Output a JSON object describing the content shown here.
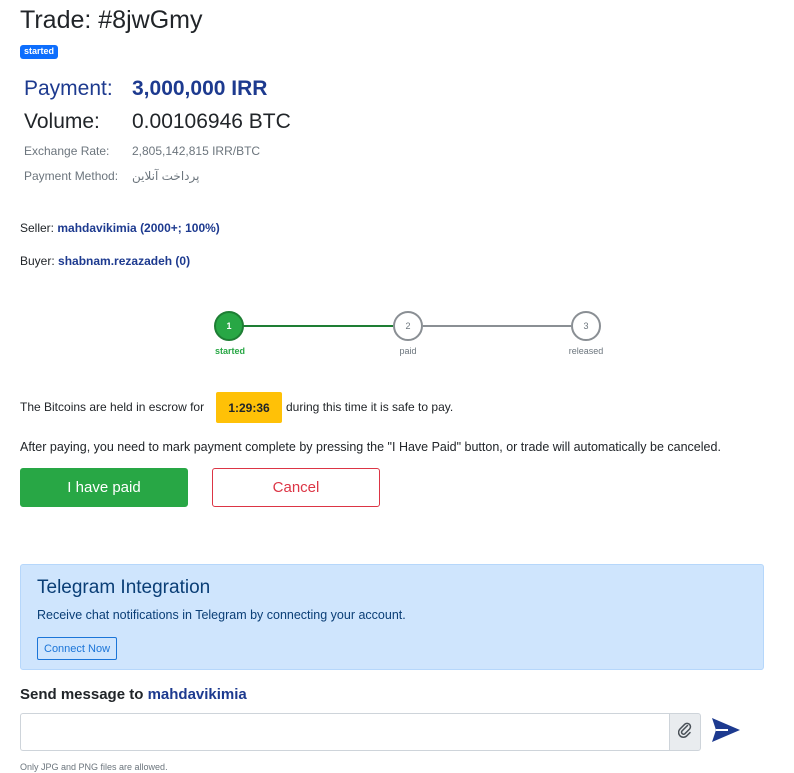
{
  "trade": {
    "title": "Trade: #8jwGmy",
    "status": "started"
  },
  "details": {
    "payment_label": "Payment:",
    "payment_value": "3,000,000 IRR",
    "volume_label": "Volume:",
    "volume_value": "0.00106946 BTC",
    "rate_label": "Exchange Rate:",
    "rate_value": "2,805,142,815 IRR/BTC",
    "method_label": "Payment Method:",
    "method_value": "پرداخت آنلاین"
  },
  "parties": {
    "seller_label": "Seller:",
    "seller_value": "mahdavikimia (2000+; 100%)",
    "buyer_label": "Buyer:",
    "buyer_value": "shabnam.rezazadeh (0)"
  },
  "stepper": {
    "steps": [
      {
        "number": "1",
        "label": "started"
      },
      {
        "number": "2",
        "label": "paid"
      },
      {
        "number": "3",
        "label": "released"
      }
    ],
    "active_step": 1
  },
  "escrow": {
    "text_before": "The Bitcoins are held in escrow for",
    "timer": "1:29:36",
    "text_after": "during this time it is safe to pay.",
    "instructions": "After paying, you need to mark payment complete by pressing the \"I Have Paid\" button, or trade will automatically be canceled."
  },
  "actions": {
    "paid_label": "I have paid",
    "cancel_label": "Cancel"
  },
  "telegram": {
    "title": "Telegram Integration",
    "description": "Receive chat notifications in Telegram by connecting your account.",
    "connect_label": "Connect Now"
  },
  "chat": {
    "heading_prefix": "Send message to",
    "recipient": "mahdavikimia",
    "input_value": "",
    "file_note": "Only JPG and PNG files are allowed."
  },
  "colors": {
    "brand_blue": "#1d3a8f",
    "success": "#28a745",
    "danger": "#dc3545",
    "warning": "#ffc107",
    "info_bg": "#cfe5fd"
  },
  "icons": {
    "attach": "paperclip-icon",
    "send": "send-icon"
  }
}
